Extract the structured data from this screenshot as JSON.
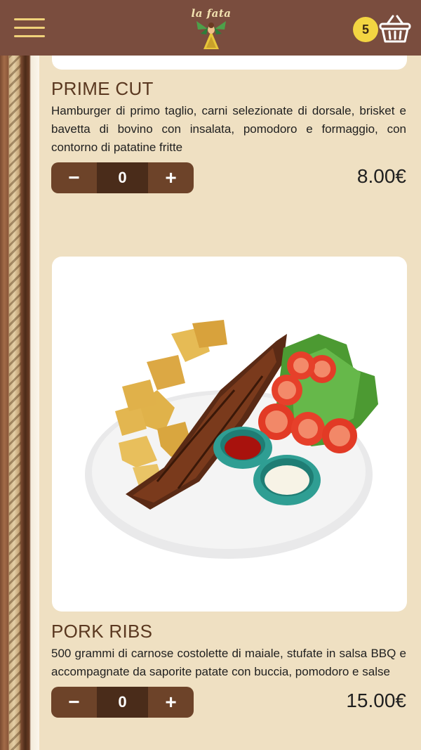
{
  "header": {
    "logo_text": "la fata",
    "cart_count": "5"
  },
  "items": [
    {
      "name": "PRIME CUT",
      "description": "Hamburger di primo taglio, carni selezionate di dorsale, brisket e bavetta di bovino con insalata, pomodoro e formaggio, con contorno di patatine fritte",
      "quantity": "0",
      "price": "8.00€",
      "minus_label": "−",
      "plus_label": "+"
    },
    {
      "name": "PORK RIBS",
      "description": "500 grammi di carnose costolette di maiale, stufate in salsa BBQ e accompagnate da saporite patate con buccia, pomodoro e salse",
      "quantity": "0",
      "price": "15.00€",
      "minus_label": "−",
      "plus_label": "+"
    }
  ],
  "colors": {
    "header": "#7a4d3e",
    "accent": "#f3d542",
    "stepper": "#6d4329",
    "background": "#efe0c2"
  }
}
